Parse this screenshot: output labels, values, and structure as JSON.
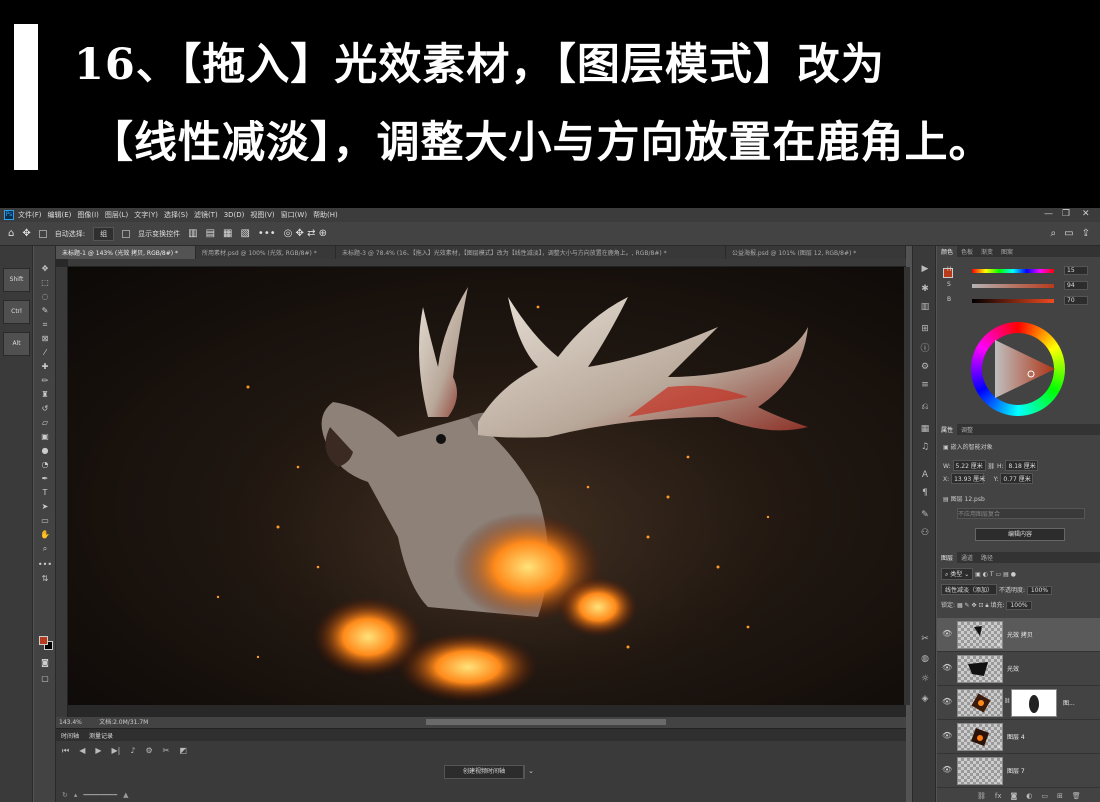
{
  "header": {
    "line1": "16、【拖入】光效素材，【图层模式】改为",
    "line2": "【线性减淡】，调整大小与方向放置在鹿角上。"
  },
  "menubar": {
    "logo": "Ps",
    "items": [
      "文件(F)",
      "编辑(E)",
      "图像(I)",
      "图层(L)",
      "文字(Y)",
      "选择(S)",
      "滤镜(T)",
      "3D(D)",
      "视图(V)",
      "窗口(W)",
      "帮助(H)"
    ]
  },
  "options_bar": {
    "auto_select_label": "自动选择:",
    "auto_select_value": "组",
    "transform_controls_label": "显示变换控件"
  },
  "doc_tabs": [
    "未标题-1 @ 143% (光效 拷贝, RGB/8#) *",
    "所用素材.psd @ 100% (光效, RGB/8#) *",
    "未标题-3 @ 78.4% (16、【拖入】光效素材，【图层模式】改为【线性减淡】，调整大小与方向放置在鹿角上。, RGB/8#) *",
    "公益海报.psd @ 101% (图层 12, RGB/8#) *"
  ],
  "modifier_keys": [
    "Shift",
    "Ctrl",
    "Alt"
  ],
  "status": {
    "zoom": "143.4%",
    "doc_size": "文档:2.0M/31.7M"
  },
  "timeline": {
    "tabs": [
      "时间轴",
      "测量记录"
    ],
    "create_button": "创建视频时间轴"
  },
  "color_panel": {
    "tabs": [
      "颜色",
      "色板",
      "渐变",
      "图案"
    ],
    "fg_color": "#b83a1c",
    "sliders": [
      {
        "label": "H",
        "value": "15"
      },
      {
        "label": "S",
        "value": "94"
      },
      {
        "label": "B",
        "value": "70"
      }
    ]
  },
  "properties_panel": {
    "tabs": [
      "属性",
      "调整"
    ],
    "object_type": "嵌入的智能对象",
    "w_label": "W:",
    "w_value": "5.22 厘米",
    "h_label": "H:",
    "h_value": "8.18 厘米",
    "x_label": "X:",
    "x_value": "13.93 厘米",
    "y_label": "Y:",
    "y_value": "0.77 厘米",
    "file_name": "图层 12.psb",
    "comp_placeholder": "不应用图层复合",
    "edit_button": "编辑内容"
  },
  "layers_panel": {
    "tabs": [
      "图层",
      "通道",
      "路径"
    ],
    "filter_type": "类型",
    "blend_mode": "线性减淡（添加）",
    "opacity_label": "不透明度:",
    "opacity_value": "100%",
    "lock_label": "锁定:",
    "fill_label": "填充:",
    "fill_value": "100%",
    "layers": [
      {
        "name": "光效 拷贝",
        "selected": true
      },
      {
        "name": "光效",
        "selected": false
      },
      {
        "name": "图...",
        "selected": false
      },
      {
        "name": "图层 4",
        "selected": false
      },
      {
        "name": "图层 7",
        "selected": false
      }
    ]
  }
}
